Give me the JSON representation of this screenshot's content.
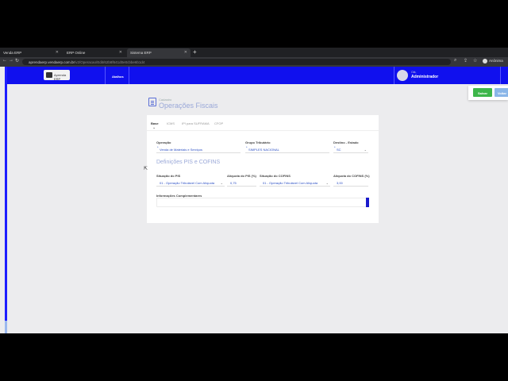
{
  "browser": {
    "tabs": [
      {
        "label": "Venda ERP"
      },
      {
        "label": "ERP Online"
      },
      {
        "label": "Sistema ERP"
      }
    ],
    "new_tab": "+",
    "url_host": "aprendaerp.vendaerp.com.br",
    "url_path": "/v2/Operacao/Edit/62b8f641d0e0cbbe6b1d4",
    "profile_label": "Anônima"
  },
  "app": {
    "logo_text": "Aprenda ERP",
    "nav_link": "Atalhos",
    "user_greeting": "Olá,",
    "user_name": "Administrador",
    "save_label": "Salvar",
    "back_label": "Voltar"
  },
  "page": {
    "breadcrumb": "Cadastro",
    "title": "Operações Fiscais"
  },
  "form": {
    "tabs": [
      "Base",
      "ICMS",
      "IPI para SUFRAMA",
      "CFOP"
    ],
    "active_tab": "Base",
    "operacao_label": "Operação",
    "operacao_value": "Venda de Materiais e Serviços",
    "grupo_label": "Grupo Tributário",
    "grupo_value": "SIMPLES NACIONAL",
    "destino_label": "Destino - Estado",
    "destino_value": "SC",
    "section_title": "Definições PIS e COFINS",
    "sit_pis_label": "Situação do PIS",
    "sit_pis_value": "01 - Operação Tributável Com Alíquota",
    "aliq_pis_label": "Alíquota do PIS (%)",
    "aliq_pis_value": "0,75",
    "sit_cofins_label": "Situação do COFINS",
    "sit_cofins_value": "01 - Operação Tributável Com Alíquota",
    "aliq_cofins_label": "Alíquota do COFINS (%)",
    "aliq_cofins_value": "3,00",
    "info_label": "Informações Complementares",
    "info_value": ""
  },
  "colors": {
    "nav_blue": "#1010ee",
    "save_green": "#3db64a",
    "back_blue": "#8ab6e8"
  }
}
